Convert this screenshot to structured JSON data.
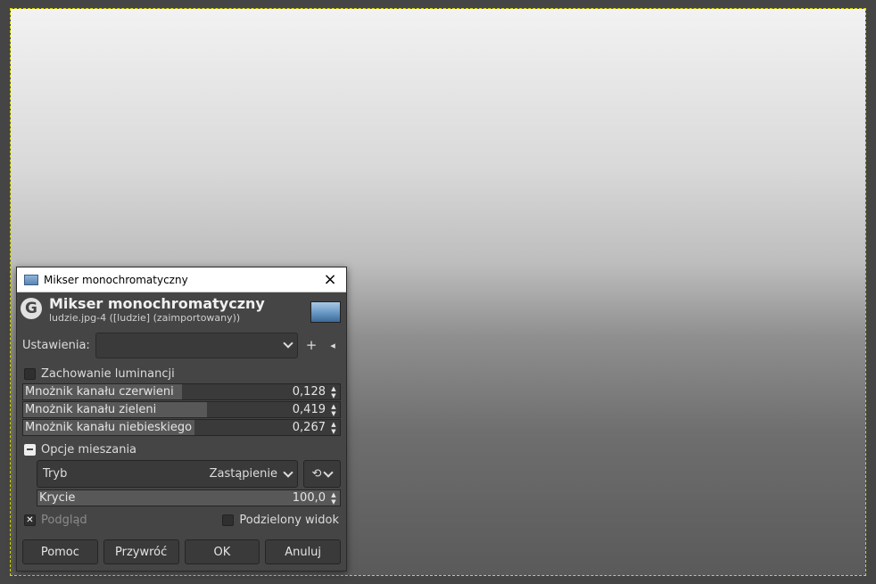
{
  "dialog": {
    "window_title": "Mikser monochromatyczny",
    "header_title": "Mikser monochromatyczny",
    "header_subtitle": "ludzie.jpg-4 ([ludzie] (zaimportowany))",
    "settings_label": "Ustawienia:",
    "settings_value": "",
    "preserve_luminosity_label": "Zachowanie luminancji",
    "preserve_luminosity_checked": false,
    "channels": [
      {
        "label": "Mnożnik kanału czerwieni",
        "value": "0,128",
        "fill_fraction": 0.5
      },
      {
        "label": "Mnożnik kanału zieleni",
        "value": "0,419",
        "fill_fraction": 0.58
      },
      {
        "label": "Mnożnik kanału niebieskiego",
        "value": "0,267",
        "fill_fraction": 0.54
      }
    ],
    "blending": {
      "section_label": "Opcje mieszania",
      "mode_label": "Tryb",
      "mode_value": "Zastąpienie",
      "opacity_label": "Krycie",
      "opacity_value": "100,0",
      "opacity_fill_fraction": 1.0
    },
    "preview_label": "Podgląd",
    "preview_checked": true,
    "split_view_label": "Podzielony widok",
    "split_view_checked": false,
    "buttons": {
      "help": "Pomoc",
      "reset": "Przywróć",
      "ok": "OK",
      "cancel": "Anuluj"
    }
  }
}
